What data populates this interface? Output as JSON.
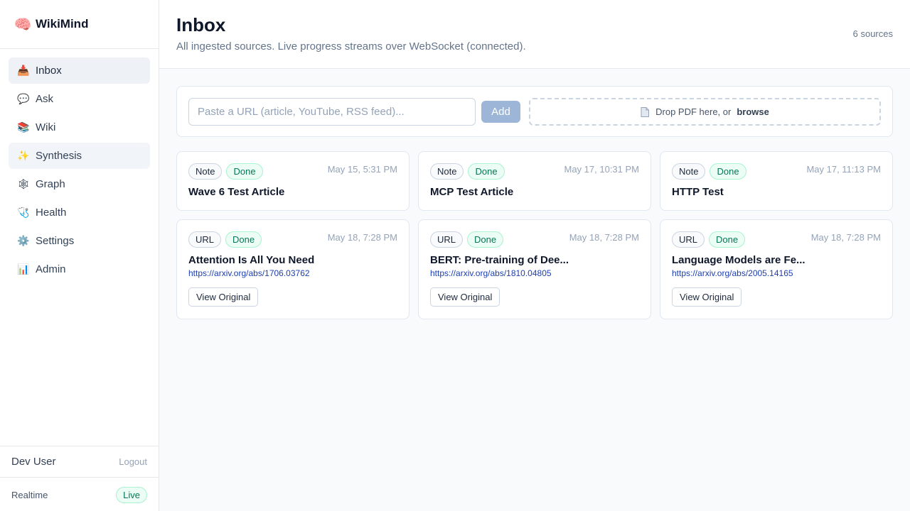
{
  "app": {
    "name": "WikiMind",
    "icon": "brain-icon"
  },
  "sidebar": {
    "items": [
      {
        "label": "Inbox",
        "icon": "inbox-tray-icon",
        "glyph": "📥"
      },
      {
        "label": "Ask",
        "icon": "speech-bubble-icon",
        "glyph": "💬"
      },
      {
        "label": "Wiki",
        "icon": "books-icon",
        "glyph": "📚"
      },
      {
        "label": "Synthesis",
        "icon": "sparkles-icon",
        "glyph": "✨"
      },
      {
        "label": "Graph",
        "icon": "network-icon",
        "glyph": "🕸"
      },
      {
        "label": "Health",
        "icon": "stethoscope-icon",
        "glyph": "🩺"
      },
      {
        "label": "Settings",
        "icon": "gear-icon",
        "glyph": "⚙️"
      },
      {
        "label": "Admin",
        "icon": "bar-chart-icon",
        "glyph": "📊"
      }
    ],
    "active": "Inbox",
    "user": {
      "name": "Dev User",
      "logout_label": "Logout"
    },
    "realtime": {
      "label": "Realtime",
      "status": "Live"
    }
  },
  "header": {
    "title": "Inbox",
    "subtitle": "All ingested sources. Live progress streams over WebSocket (connected).",
    "count": "6 sources"
  },
  "ingest": {
    "url_placeholder": "Paste a URL (article, YouTube, RSS feed)...",
    "url_value": "",
    "add_label": "Add",
    "drop_text": "Drop PDF here, or",
    "browse_label": "browse"
  },
  "cards": [
    {
      "type": "Note",
      "status": "Done",
      "date": "May 15, 5:31 PM",
      "title": "Wave 6 Test Article"
    },
    {
      "type": "Note",
      "status": "Done",
      "date": "May 17, 10:31 PM",
      "title": "MCP Test Article"
    },
    {
      "type": "Note",
      "status": "Done",
      "date": "May 17, 11:13 PM",
      "title": "HTTP Test"
    },
    {
      "type": "URL",
      "status": "Done",
      "date": "May 18, 7:28 PM",
      "title": "Attention Is All You Need",
      "url": "https://arxiv.org/abs/1706.03762",
      "action": "View Original"
    },
    {
      "type": "URL",
      "status": "Done",
      "date": "May 18, 7:28 PM",
      "title": "BERT: Pre-training of Dee...",
      "url": "https://arxiv.org/abs/1810.04805",
      "action": "View Original"
    },
    {
      "type": "URL",
      "status": "Done",
      "date": "May 18, 7:28 PM",
      "title": "Language Models are Fe...",
      "url": "https://arxiv.org/abs/2005.14165",
      "action": "View Original"
    }
  ],
  "colors": {
    "accent": "#9db5d6",
    "done": "#047857",
    "link": "#1e40af"
  }
}
